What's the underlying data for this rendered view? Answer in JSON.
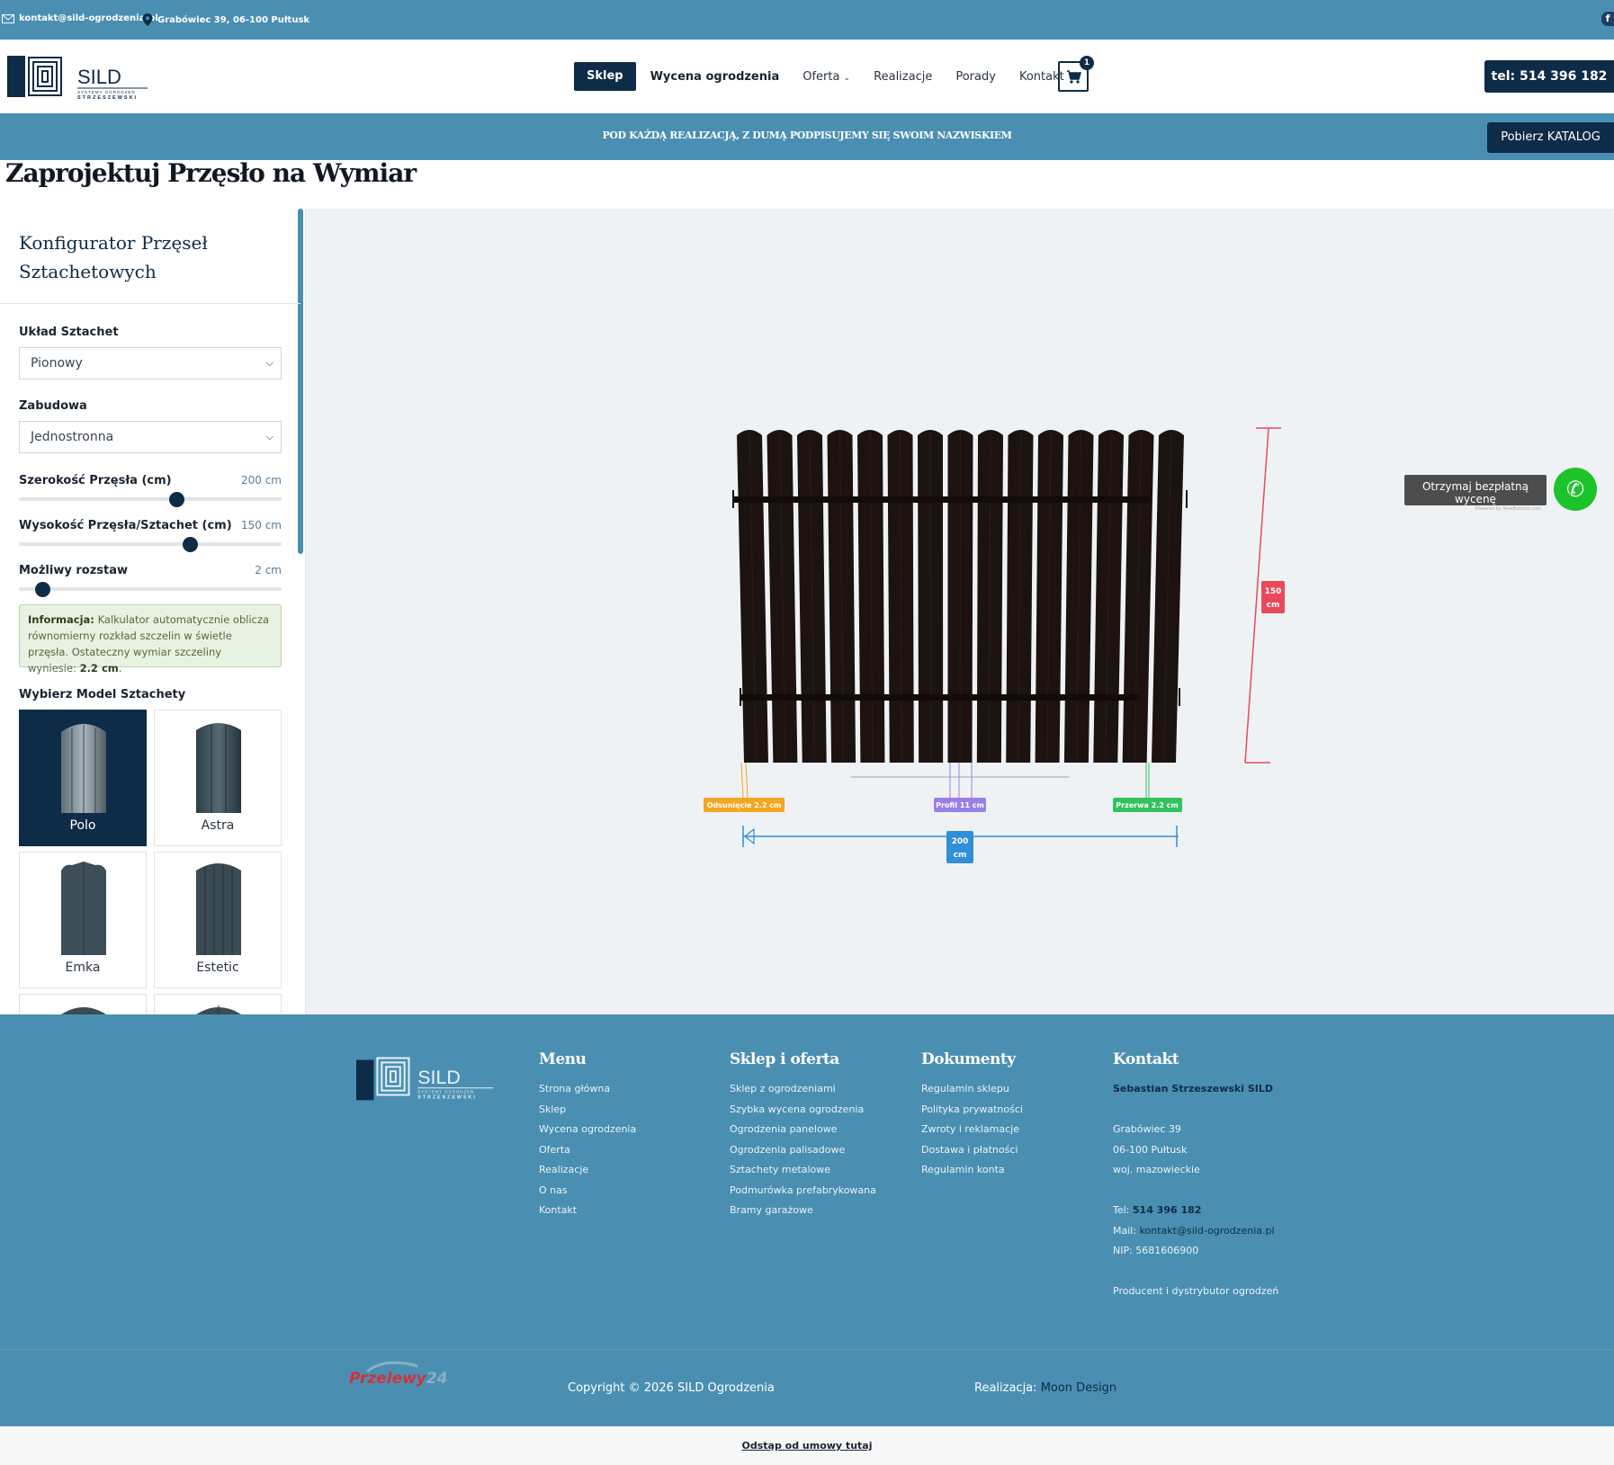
{
  "topbar": {
    "email": "kontakt@sild-ogrodzenia.pl",
    "address": "Grabówiec 39, 06-100 Pułtusk",
    "facebook_icon": "facebook-icon"
  },
  "header": {
    "logo": {
      "brand": "SILD",
      "tagline1": "SYSTEMY OGRODZEŃ",
      "tagline2": "STRZESZEWSKI"
    },
    "nav": {
      "shop": "Sklep",
      "quote": "Wycena ogrodzenia",
      "offer": "Oferta",
      "projects": "Realizacje",
      "tips": "Porady",
      "contact": "Kontakt"
    },
    "cart_count": "1",
    "phone": "tel: 514 396 182"
  },
  "banner": {
    "slogan": "POD KAŻDĄ REALIZACJĄ, Z DUMĄ PODPISUJEMY SIĘ SWOIM NAZWISKIEM",
    "catalog": "Pobierz KATALOG"
  },
  "page_title": "Zaprojektuj Przęsło na Wymiar",
  "configurator": {
    "title": "Konfigurator Przęseł Sztachetowych",
    "layout_label": "Układ Sztachet",
    "layout_value": "Pionowy",
    "build_label": "Zabudowa",
    "build_value": "Jednostronna",
    "width": {
      "label": "Szerokość Przęsła (cm)",
      "value": "200 cm",
      "fraction": 0.6
    },
    "height": {
      "label": "Wysokość Przęsła/Sztachet (cm)",
      "value": "150 cm",
      "fraction": 0.65
    },
    "spacing": {
      "label": "Możliwy rozstaw",
      "value": "2 cm",
      "fraction": 0.09
    },
    "info": {
      "bold": "Informacja:",
      "text": "Kalkulator automatycznie oblicza równomierny rozkład szczelin w świetle przęsła. Ostateczny wymiar szczeliny wyniesie:",
      "gap": "2.2 cm"
    },
    "model_title": "Wybierz Model Sztachety",
    "models": [
      "Polo",
      "Astra",
      "Emka",
      "Estetic"
    ]
  },
  "preview": {
    "height_label": "150 cm",
    "width_label": "200 cm",
    "offset_label": "Odsunięcie 2.2 cm",
    "profile_label": "Profil 11 cm",
    "gap_label": "Przerwa 2.2 cm",
    "cta": "Otrzymaj bezpłatną wycenę",
    "cta_powered": "Powered by NowButtons.com",
    "colors": {
      "picket": "#1c1210",
      "height_line": "#e8495a",
      "width_line": "#2f8fd8",
      "offset": "#f5a623",
      "profile": "#9b7fe8",
      "gap": "#33c25e"
    }
  },
  "footer": {
    "menu": {
      "title": "Menu",
      "items": [
        "Strona główna",
        "Sklep",
        "Wycena ogrodzenia",
        "Oferta",
        "Realizacje",
        "O nas",
        "Kontakt"
      ]
    },
    "shop": {
      "title": "Sklep i oferta",
      "items": [
        "Sklep z ogrodzeniami",
        "Szybka wycena ogrodzenia",
        "Ogrodzenia panelowe",
        "Ogrodzenia palisadowe",
        "Sztachety metalowe",
        "Podmurówka prefabrykowana",
        "Bramy garażowe"
      ]
    },
    "docs": {
      "title": "Dokumenty",
      "items": [
        "Regulamin sklepu",
        "Polityka prywatności",
        "Zwroty i reklamacje",
        "Dostawa i płatności",
        "Regulamin konta"
      ]
    },
    "contact": {
      "title": "Kontakt",
      "company": "Sebastian Strzeszewski SILD",
      "street": "Grabówiec 39",
      "city": "06-100 Pułtusk",
      "region": "woj. mazowieckie",
      "tel_label": "Tel:",
      "tel": "514 396 182",
      "mail_label": "Mail:",
      "mail": "kontakt@sild-ogrodzenia.pl",
      "nip": "NIP: 5681606900",
      "producer": "Producent i dystrybutor ogrodzeń"
    },
    "payment": {
      "p": "Przelewy",
      "n": "24"
    },
    "copyright": "Copyright © 2026 SILD Ogrodzenia",
    "realization_label": "Realizacja:",
    "realization_name": "Moon Design",
    "withdrawal": "Odstąp od umowy tutaj"
  }
}
